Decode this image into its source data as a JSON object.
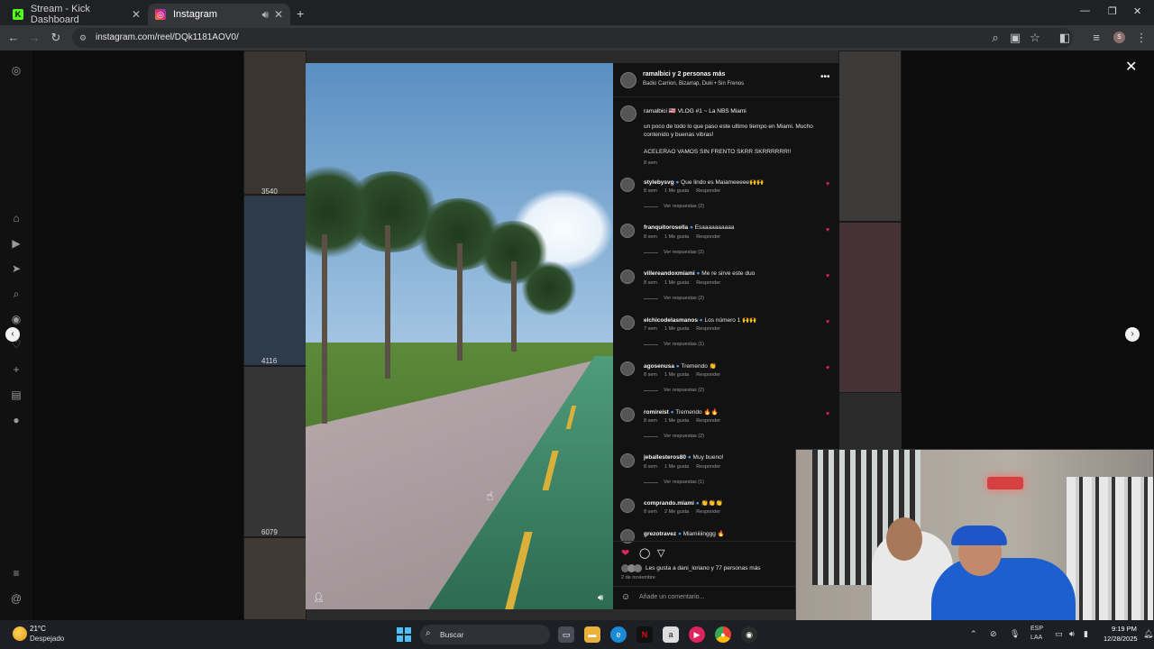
{
  "browser": {
    "tabs": [
      {
        "label": "Stream - Kick Dashboard",
        "favicon": "kick-icon",
        "accent": "#53fc18"
      },
      {
        "label": "Instagram",
        "favicon": "instagram-icon",
        "accent": "#e1306c"
      }
    ],
    "url": "instagram.com/reel/DQk1181AOV0/"
  },
  "background_grid": {
    "counts": [
      "3540",
      "4116",
      "6079"
    ]
  },
  "post": {
    "header_user": "ramalbici y 2 personas más",
    "audio": "Badio Carrion, Bizarrap, Duki • Sin Frenos",
    "caption_user": "ramalbici 🇺🇸 VLOG #1 ~ La NBS Miami",
    "caption_body": "un poco de todo lo que paso este ultimo tiempo en Miami. Mucho contenido y buenas vibras!",
    "caption_extra": "ACELERAO VAMOS SIN FRENTO SKRR SKRRRRRR!!",
    "caption_time": "8 sem",
    "likes": "Les gusta a dani_loriano y 77 personas más",
    "date": "2 de noviembre",
    "add_comment_placeholder": "Añade un comentario..."
  },
  "comments": [
    {
      "user": "stylebysvg",
      "text": "Que lindo es Maiameeeee🙌🙌",
      "time": "8 sem",
      "likes": "1 Me gusta",
      "reply": "Responder",
      "replies": "Ver respuestas (2)"
    },
    {
      "user": "franquitorosella",
      "text": "Esaaaaaaaaaa",
      "time": "8 sem",
      "likes": "1 Me gusta",
      "reply": "Responder",
      "replies": "Ver respuestas (2)"
    },
    {
      "user": "villereandoxmiami",
      "text": "Me re sirve este duo",
      "time": "8 sem",
      "likes": "1 Me gusta",
      "reply": "Responder",
      "replies": "Ver respuestas (2)"
    },
    {
      "user": "elchicodelasmanos",
      "text": "Los número 1 🙌🙌",
      "time": "7 sem",
      "likes": "1 Me gusta",
      "reply": "Responder",
      "replies": "Ver respuestas (1)"
    },
    {
      "user": "agosenusa",
      "text": "Tremendo 👏",
      "time": "8 sem",
      "likes": "1 Me gusta",
      "reply": "Responder",
      "replies": "Ver respuestas (2)"
    },
    {
      "user": "romireist",
      "text": "Tremendo 🔥🔥",
      "time": "8 sem",
      "likes": "1 Me gusta",
      "reply": "Responder",
      "replies": "Ver respuestas (2)"
    },
    {
      "user": "jeballesteros80",
      "text": "Muy bueno!",
      "time": "8 sem",
      "likes": "1 Me gusta",
      "reply": "Responder",
      "replies": "Ver respuestas (1)"
    },
    {
      "user": "comprando.miami",
      "text": "👏👏👏",
      "time": "8 sem",
      "likes": "2 Me gusta",
      "reply": "Responder",
      "replies": ""
    },
    {
      "user": "grezotravez",
      "text": "Miamiiiinggg 🔥",
      "time": "",
      "likes": "",
      "reply": "",
      "replies": ""
    }
  ],
  "taskbar": {
    "weather_temp": "21°C",
    "weather_desc": "Despejado",
    "search_label": "Buscar",
    "lang_line1": "ESP",
    "lang_line2": "LAA",
    "time": "9:19 PM",
    "date": "12/28/2025"
  },
  "colors": {
    "like_red": "#e0245e",
    "verified_blue": "#3897f0",
    "windows_blue": "#4cc2ff"
  }
}
